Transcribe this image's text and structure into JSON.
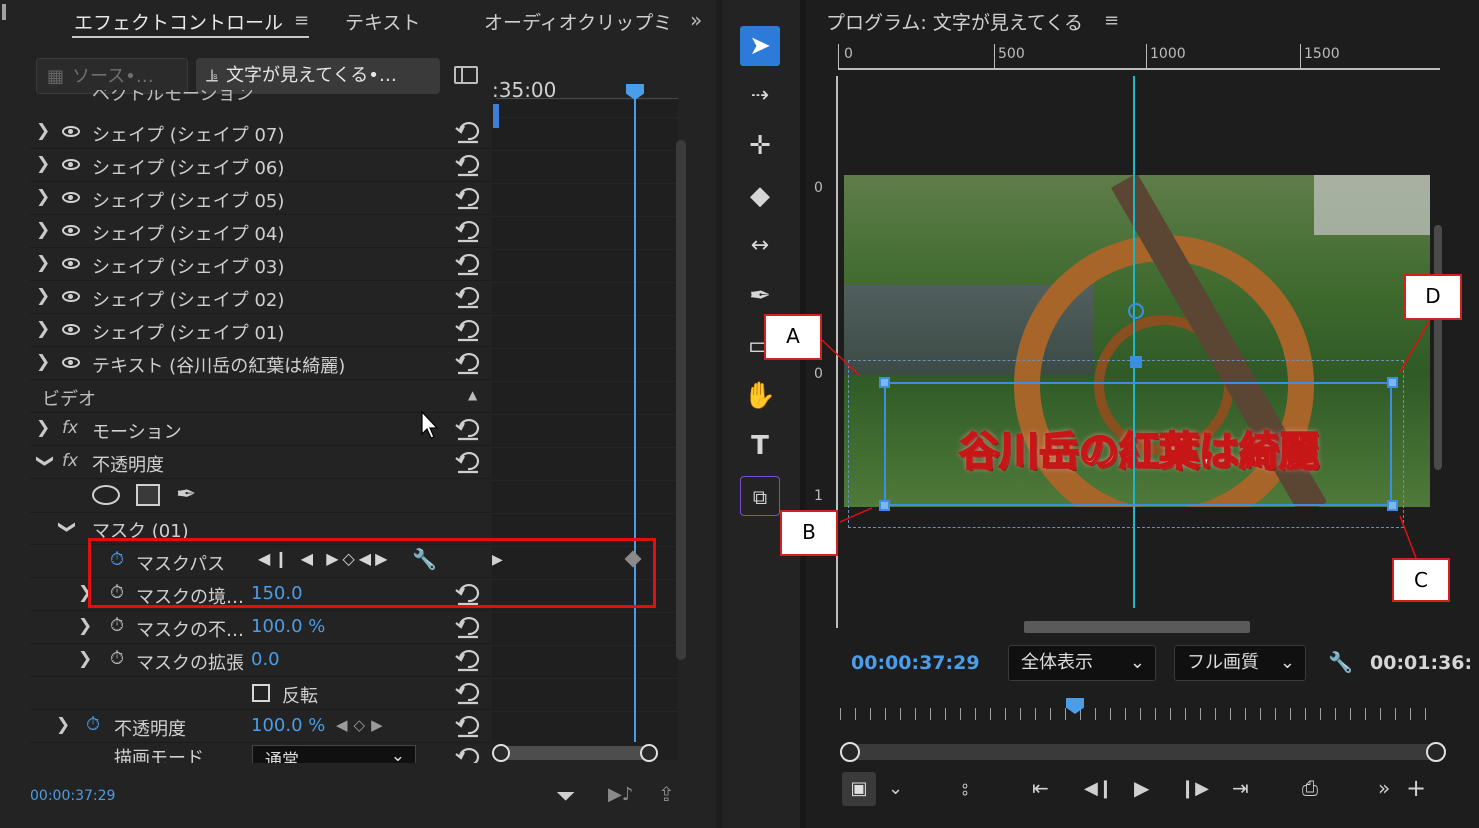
{
  "effect_controls": {
    "tabs": [
      {
        "label": "エフェクトコントロール"
      },
      {
        "label": "テキスト"
      },
      {
        "label": "オーディオクリップミ"
      }
    ],
    "source_inactive": "ソース•…",
    "source_active": "文字が見えてくる•…",
    "timecode_ruler": ":35:00",
    "partial_row": "ベクトルモーション",
    "shape_rows": [
      {
        "label": "シェイプ (シェイプ 07)"
      },
      {
        "label": "シェイプ (シェイプ 06)"
      },
      {
        "label": "シェイプ (シェイプ 05)"
      },
      {
        "label": "シェイプ (シェイプ 04)"
      },
      {
        "label": "シェイプ (シェイプ 03)"
      },
      {
        "label": "シェイプ (シェイプ 02)"
      },
      {
        "label": "シェイプ (シェイプ 01)"
      }
    ],
    "text_row": "テキスト (谷川岳の紅葉は綺麗)",
    "video_section": "ビデオ",
    "motion": "モーション",
    "opacity": "不透明度",
    "mask": "マスク (01)",
    "mask_path": "マスクパス",
    "mask_feather": {
      "label": "マスクの境…",
      "value": "150.0"
    },
    "mask_opacity": {
      "label": "マスクの不…",
      "value": "100.0 %"
    },
    "mask_expansion": {
      "label": "マスクの拡張",
      "value": "0.0"
    },
    "invert": "反転",
    "opacity_prop": {
      "label": "不透明度",
      "value": "100.0 %"
    },
    "blend_mode": {
      "label": "描画モード",
      "value": "通常"
    },
    "timecode": "00:00:37:29"
  },
  "program_monitor": {
    "title": "プログラム: 文字が見えてくる",
    "ruler_labels": [
      "0",
      "500",
      "1000",
      "1500"
    ],
    "vruler_labels": [
      "0",
      "0",
      "1"
    ],
    "video_caption": "谷川岳の紅葉は綺麗",
    "timecode_current": "00:00:37:29",
    "zoom": "全体表示",
    "quality": "フル画質",
    "timecode_duration": "00:01:36:"
  },
  "callouts": {
    "a": "A",
    "b": "B",
    "c": "C",
    "d": "D"
  },
  "colors": {
    "accent": "#4a9de8",
    "highlight_box": "#e01010",
    "guide": "#1fb8c8",
    "mask_path": "#3d8ee0"
  }
}
